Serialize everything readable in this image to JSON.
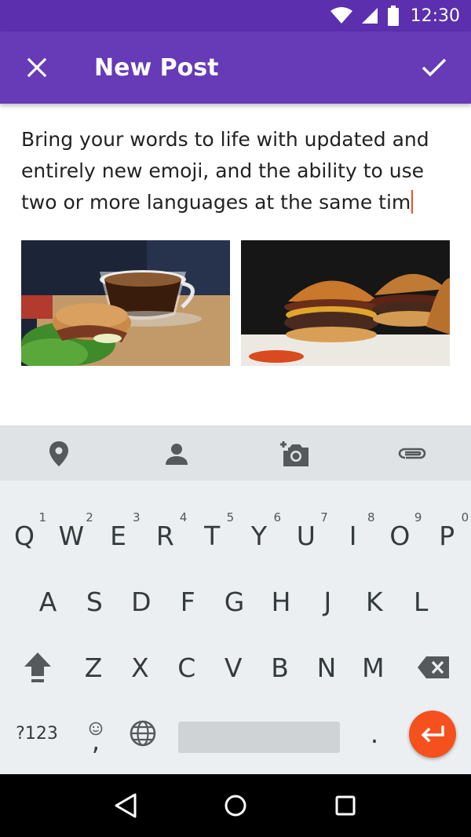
{
  "status_bar": {
    "time": "12:30",
    "icons": [
      "wifi-icon",
      "signal-icon",
      "battery-icon"
    ]
  },
  "app_bar": {
    "title": "New Post",
    "close_icon": "close-icon",
    "confirm_icon": "check-icon",
    "color": "#673ab7"
  },
  "post": {
    "text": "Bring your words to life with updated and entirely new emoji, and the ability to use two or more languages at the same tim",
    "images": [
      "coffee-and-sandwich-photo",
      "burgers-photo"
    ]
  },
  "toolbar": {
    "items": [
      "location-icon",
      "person-icon",
      "add-photo-icon",
      "attach-icon"
    ]
  },
  "keyboard": {
    "row1": [
      {
        "key": "Q",
        "hint": "1"
      },
      {
        "key": "W",
        "hint": "2"
      },
      {
        "key": "E",
        "hint": "3"
      },
      {
        "key": "R",
        "hint": "4"
      },
      {
        "key": "T",
        "hint": "5"
      },
      {
        "key": "Y",
        "hint": "6"
      },
      {
        "key": "U",
        "hint": "7"
      },
      {
        "key": "I",
        "hint": "8"
      },
      {
        "key": "O",
        "hint": "9"
      },
      {
        "key": "P",
        "hint": "0"
      }
    ],
    "row2": [
      "A",
      "S",
      "D",
      "F",
      "G",
      "H",
      "J",
      "K",
      "L"
    ],
    "row3": [
      "Z",
      "X",
      "C",
      "V",
      "B",
      "N",
      "M"
    ],
    "symbols_key": "?123",
    "comma_key": ",",
    "period_key": ".",
    "accent_color": "#f4511e"
  },
  "nav_bar": {
    "items": [
      "back-icon",
      "home-icon",
      "recents-icon"
    ]
  }
}
